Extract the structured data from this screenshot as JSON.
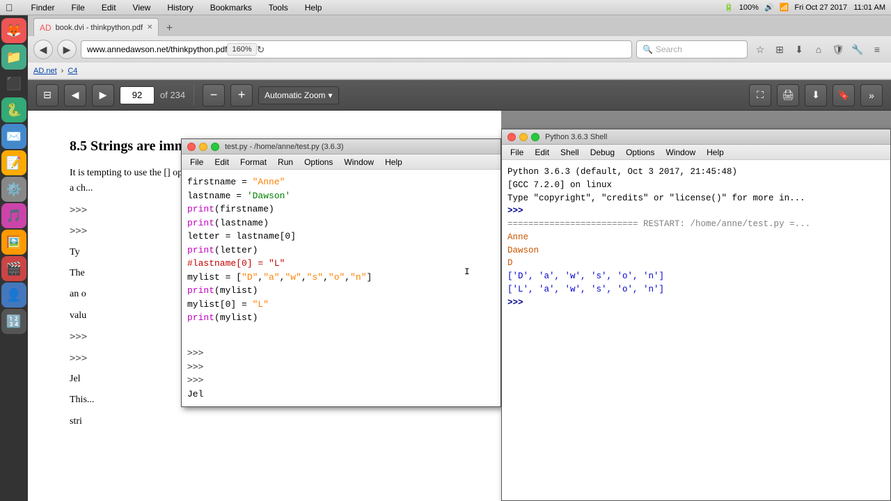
{
  "menubar": {
    "apple": "&#63743;",
    "items": [
      "Finder",
      "File",
      "Edit",
      "View",
      "History",
      "Bookmarks",
      "Tools",
      "Help"
    ],
    "right": {
      "time": "11:01 AM",
      "date": "Fri Oct 27 2017",
      "battery": "100%",
      "wifi": "WiFi"
    }
  },
  "browser": {
    "tab_title": "book.dvi - thinkpython.pdf",
    "url": "www.annedawson.net/thinkpython.pdf",
    "zoom": "160%",
    "search_placeholder": "Search",
    "breadcrumb": {
      "site": "AD.net",
      "section": "C4"
    }
  },
  "pdf_toolbar": {
    "page_current": "92",
    "page_total": "of 234",
    "zoom_label": "Automatic Zoom"
  },
  "pdf_content": {
    "section": "8.5   Strings are immutable",
    "paragraph1": "It is tempting to use the [] operator on the left side of an assignment, with the intention of changing a ch...",
    "prompts": [
      ">>>",
      ">>>",
      "Ty",
      "The",
      "an o",
      "valu"
    ],
    "paragraph2": "The...",
    "jellyfish": "Jel",
    "last_paragraph": "This...",
    "last_line": "stri"
  },
  "idle_editor": {
    "title": "test.py - /home/anne/test.py (3.6.3)",
    "menu_items": [
      "File",
      "Edit",
      "Format",
      "Run",
      "Options",
      "Window",
      "Help"
    ],
    "code_lines": [
      {
        "type": "normal",
        "content": "firstname = ",
        "str_part": "\"Anne\"",
        "str_color": "orange"
      },
      {
        "type": "normal",
        "content": "lastname = ",
        "str_part": "'Dawson'",
        "str_color": "green"
      },
      {
        "type": "kw",
        "content": "print(firstname)"
      },
      {
        "type": "kw",
        "content": "print(lastname)"
      },
      {
        "type": "normal",
        "content": "letter = lastname[0]"
      },
      {
        "type": "kw",
        "content": "print(letter)"
      },
      {
        "type": "comment",
        "content": "#lastname[0] = \"L\""
      },
      {
        "type": "normal",
        "content": "mylist = [\"D\",\"a\",\"w\",\"s\",\"o\",\"n\"]"
      },
      {
        "type": "kw",
        "content": "print(mylist)"
      },
      {
        "type": "normal",
        "content": "mylist[0] = ",
        "str_part": "\"L\"",
        "str_color": "orange"
      },
      {
        "type": "kw",
        "content": "print(mylist)"
      }
    ]
  },
  "python_shell": {
    "title": "Python 3.6.3 Shell",
    "menu_items": [
      "File",
      "Edit",
      "Shell",
      "Debug",
      "Options",
      "Window",
      "Help"
    ],
    "banner_line1": "Python 3.6.3 (default, Oct  3 2017, 21:45:48)",
    "banner_line2": "[GCC 7.2.0] on linux",
    "banner_line3": "Type \"copyright\", \"credits\" or \"license()\" for more in...",
    "prompt1": ">>>",
    "restart_line": "========================= RESTART: /home/anne/test.py =...",
    "output_anne": "Anne",
    "output_dawson": "Dawson",
    "output_d": "D",
    "output_list1": "['D', 'a', 'w', 's', 'o', 'n']",
    "output_list2": "['L', 'a', 'w', 's', 'o', 'n']",
    "prompt2": ">>>"
  }
}
